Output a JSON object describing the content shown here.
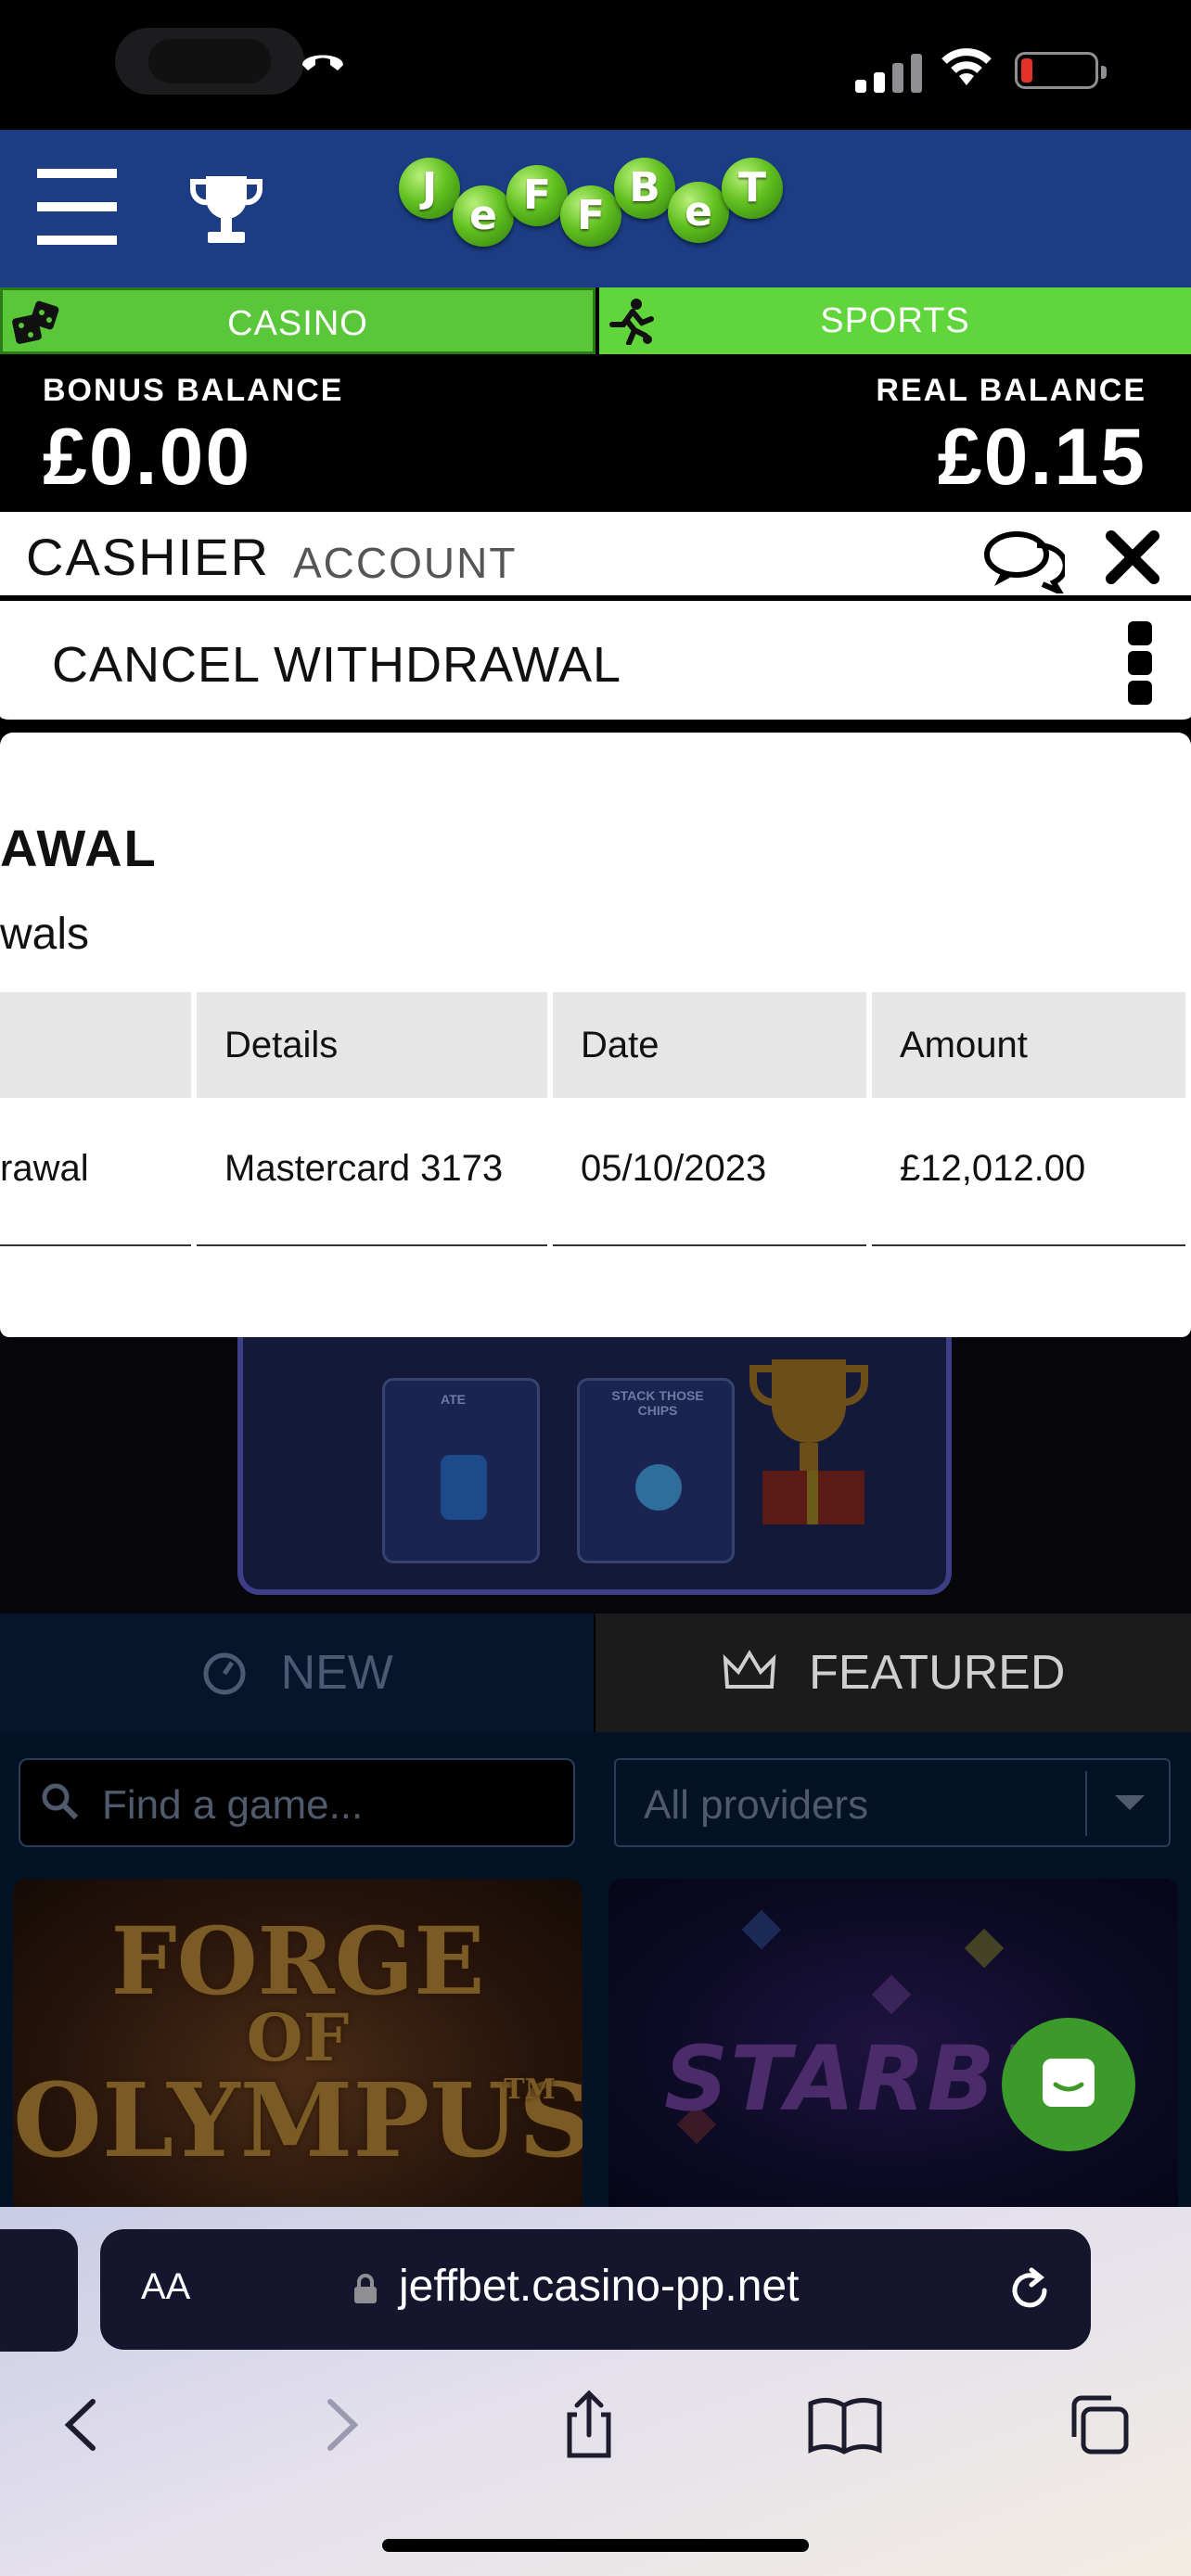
{
  "status_bar": {
    "icons": [
      "phone-icon",
      "signal-icon",
      "wifi-icon",
      "battery-icon"
    ],
    "battery_color": "#e5312b"
  },
  "header": {
    "logo_letters": [
      "J",
      "e",
      "F",
      "F",
      "B",
      "e",
      "T"
    ],
    "background": "#1c3d84"
  },
  "modes": {
    "casino": "CASINO",
    "sports": "SPORTS",
    "accent": "#5fcf37"
  },
  "balances": {
    "bonus_label": "BONUS BALANCE",
    "bonus_value": "£0.00",
    "real_label": "REAL BALANCE",
    "real_value": "£0.15"
  },
  "panel": {
    "tab_cashier": "CASHIER",
    "tab_account": "ACCOUNT",
    "subheader_title": "CANCEL WITHDRAWAL"
  },
  "withdrawals": {
    "title": "AWAL",
    "subtitle": "wals",
    "columns": [
      "",
      "Details",
      "Date",
      "Amount"
    ],
    "rows": [
      {
        "type": "rawal",
        "details": "Mastercard 3173",
        "date": "05/10/2023",
        "amount": "£12,012.00"
      }
    ]
  },
  "lobby": {
    "tab_new": "NEW",
    "tab_featured": "FEATURED",
    "promo_card_1": "ATE",
    "promo_card_2": "STACK THOSE CHIPS",
    "search_placeholder": "Find a game...",
    "providers_value": "All providers",
    "games": [
      {
        "title_lines": [
          "FORGE",
          "OF",
          "OLYMPUS"
        ],
        "mark": "TM"
      },
      {
        "title": "STARBU"
      }
    ]
  },
  "browser": {
    "text_size_label": "AA",
    "url": "jeffbet.casino-pp.net"
  }
}
